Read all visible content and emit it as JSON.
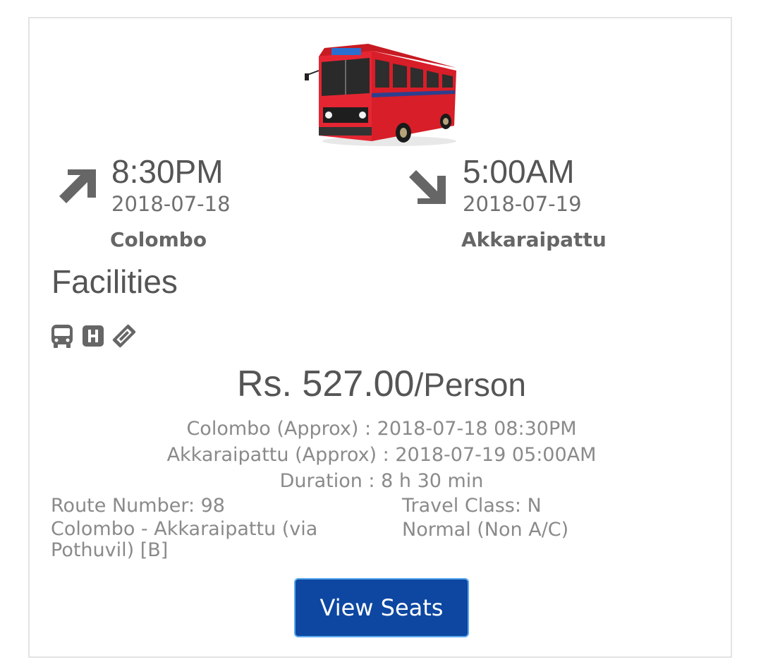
{
  "departure": {
    "time": "8:30PM",
    "date": "2018-07-18",
    "city": "Colombo",
    "icon": "arrow-up-right-icon"
  },
  "arrival": {
    "time": "5:00AM",
    "date": "2018-07-19",
    "city": "Akkaraipattu",
    "icon": "arrow-down-right-icon"
  },
  "bus_image": "red-bus-image",
  "facilities": {
    "title": "Facilities",
    "icons": [
      "bus-icon",
      "hospital-icon",
      "ticket-icon"
    ]
  },
  "price": {
    "amount": "Rs. 527.00",
    "unit": "/Person"
  },
  "schedule": {
    "departure_approx": "Colombo (Approx) : 2018-07-18 08:30PM",
    "arrival_approx": "Akkaraipattu (Approx) : 2018-07-19 05:00AM",
    "duration": "Duration : 8 h 30 min"
  },
  "route": {
    "number": "Route Number: 98",
    "name": "Colombo - Akkaraipattu (via Pothuvil) [B]"
  },
  "travel_class": {
    "code": "Travel Class: N",
    "name": "Normal (Non A/C)"
  },
  "actions": {
    "view_seats_label": "View Seats"
  },
  "colors": {
    "button": "#0d47a1",
    "button_border": "#5aa9f0",
    "bus_red": "#e0202a",
    "text_dark": "#555555",
    "text_muted": "#8a8a8a"
  }
}
